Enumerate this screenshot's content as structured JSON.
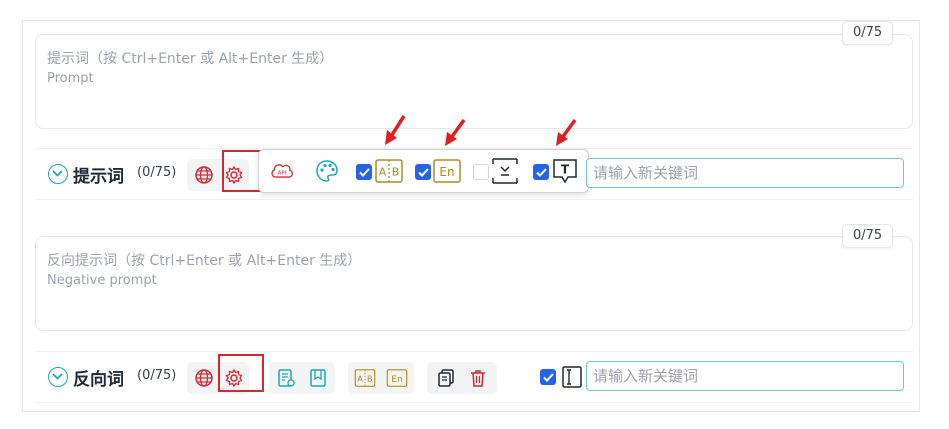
{
  "positive": {
    "placeholder_line1": "提示词（按 Ctrl+Enter 或 Alt+Enter 生成）",
    "placeholder_line2": "Prompt",
    "counter": "0/75",
    "row_title": "提示词",
    "row_count": "(0/75)",
    "keyword_placeholder": "请输入新关键词",
    "toolbar_checks": {
      "ab": true,
      "en": true,
      "dismiss": false,
      "text": true
    }
  },
  "negative": {
    "placeholder_line1": "反向提示词（按 Ctrl+Enter 或 Alt+Enter 生成）",
    "placeholder_line2": "Negative prompt",
    "counter": "0/75",
    "row_title": "反向词",
    "row_count": "(0/75)",
    "keyword_placeholder": "请输入新关键词",
    "text_check": true
  },
  "icons": {
    "ab_label": "A|B",
    "en_label": "En",
    "api_label": "API",
    "t_label": "T"
  },
  "colors": {
    "accent": "#1aa9b6",
    "red": "#d6282e",
    "gold": "#b58a1e",
    "blue": "#2563eb"
  }
}
